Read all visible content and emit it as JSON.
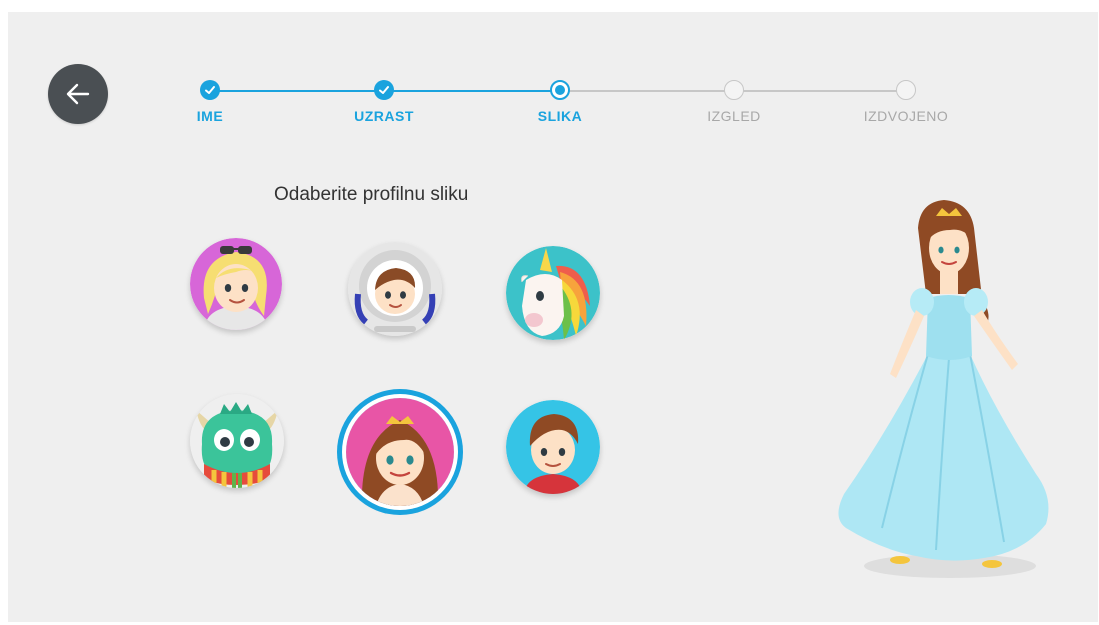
{
  "navigation": {
    "back_icon": "arrow-left-icon"
  },
  "stepper": {
    "steps": [
      {
        "label": "IME",
        "state": "done"
      },
      {
        "label": "UZRAST",
        "state": "done"
      },
      {
        "label": "SLIKA",
        "state": "current"
      },
      {
        "label": "IZGLED",
        "state": "todo"
      },
      {
        "label": "IZDVOJENO",
        "state": "todo"
      }
    ],
    "active_color": "#1aa3de",
    "inactive_color": "#a8a8a8"
  },
  "avatar_picker": {
    "prompt": "Odaberite profilnu sliku",
    "avatars": [
      {
        "id": "blonde-girl",
        "selected": false
      },
      {
        "id": "astronaut-boy",
        "selected": false
      },
      {
        "id": "rainbow-unicorn",
        "selected": false
      },
      {
        "id": "green-monster",
        "selected": false
      },
      {
        "id": "princess",
        "selected": true
      },
      {
        "id": "brown-hair-boy",
        "selected": false
      }
    ]
  },
  "preview": {
    "character": "princess-full-body"
  }
}
